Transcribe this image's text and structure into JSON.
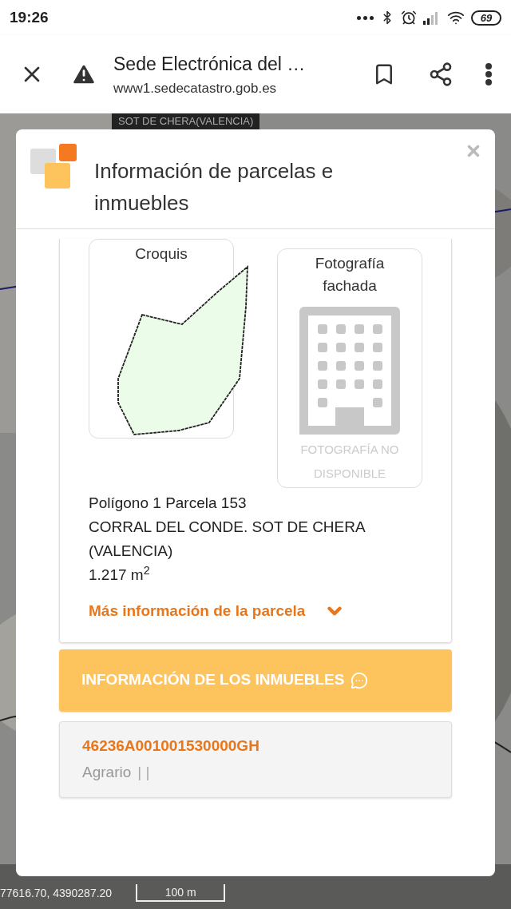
{
  "status_bar": {
    "time": "19:26",
    "battery": "69"
  },
  "browser": {
    "title": "Sede Electrónica del …",
    "url": "www1.sedecatastro.gob.es"
  },
  "map": {
    "location": "SOT DE CHERA(VALENCIA)",
    "coordinates": "77616.70, 4390287.20",
    "scale": "100 m"
  },
  "dialog": {
    "title": "Información de parcelas e inmuebles",
    "sketch_label": "Croquis",
    "photo_label": "Fotografía fachada",
    "photo_placeholder": "FOTOGRAFÍA NO DISPONIBLE",
    "parcel_lines": [
      "Polígono 1 Parcela 153",
      "CORRAL DEL CONDE. SOT DE CHERA (VALENCIA)",
      "1.217 m$^{2}$"
    ],
    "more_link": {
      "label": "Más información de la parcela",
      "expanded": false
    },
    "properties_header": "INFORMACIÓN DE LOS INMUEBLES",
    "properties": [
      {
        "reference": "46236A001001530000GH",
        "use": "Agrario",
        "separators": "| |"
      }
    ]
  }
}
